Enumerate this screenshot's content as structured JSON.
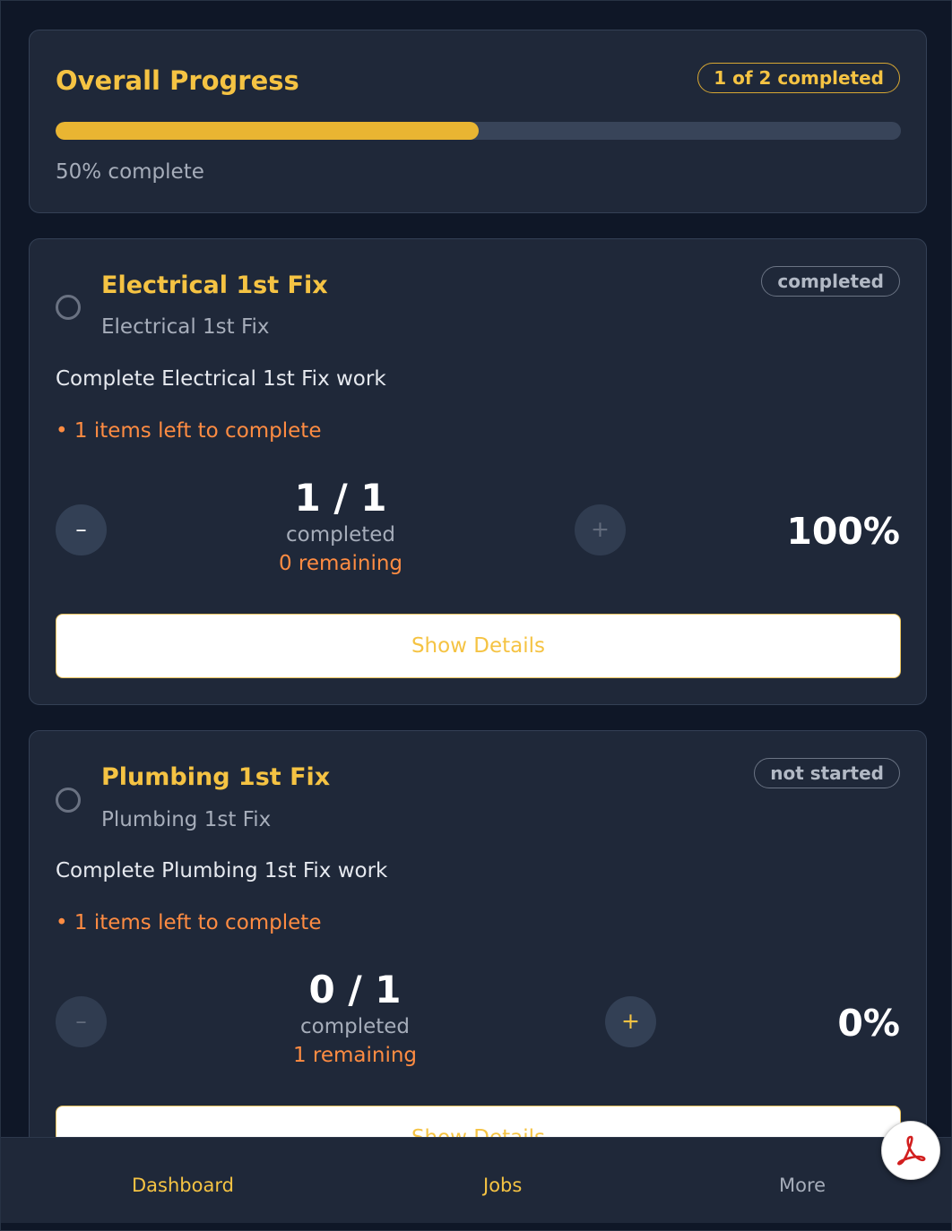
{
  "overall": {
    "title": "Overall Progress",
    "badge": "1 of 2 completed",
    "progress_fraction": 0.5,
    "progress_text": "50% complete"
  },
  "tasks": [
    {
      "title": "Electrical 1st Fix",
      "subtitle": "Electrical 1st Fix",
      "status": "completed",
      "description": "Complete Electrical 1st Fix work",
      "items_left": "• 1 items left to complete",
      "minus_label": "–",
      "plus_label": "+",
      "counter": "1 / 1",
      "counter_label": "completed",
      "remaining": "0 remaining",
      "percent": "100%",
      "details_label": "Show Details"
    },
    {
      "title": "Plumbing 1st Fix",
      "subtitle": "Plumbing 1st Fix",
      "status": "not started",
      "description": "Complete Plumbing 1st Fix work",
      "items_left": "• 1 items left to complete",
      "minus_label": "–",
      "plus_label": "+",
      "counter": "0 / 1",
      "counter_label": "completed",
      "remaining": "1 remaining",
      "percent": "0%",
      "details_label": "Show Details"
    }
  ],
  "nav": {
    "dashboard": "Dashboard",
    "jobs": "Jobs",
    "more": "More"
  },
  "fab": {
    "icon": "pdf-icon"
  },
  "colors": {
    "accent": "#f5c343",
    "progress_fill": "#e9b532",
    "warning": "#ff8c42",
    "card_bg": "#1f2839",
    "page_bg": "#0f1727"
  }
}
